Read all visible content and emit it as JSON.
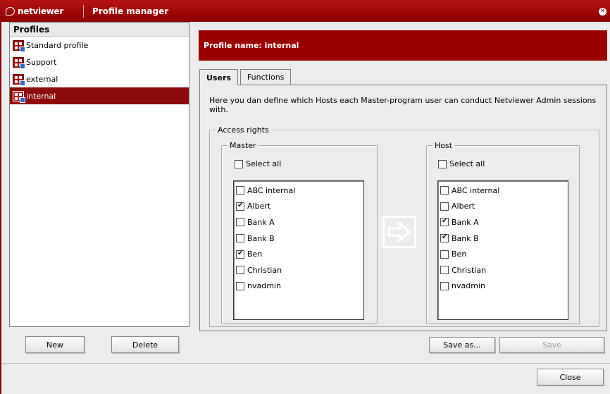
{
  "titlebar": {
    "brand": "netviewer",
    "title": "Profile manager",
    "close_icon": "close-icon"
  },
  "sidebar": {
    "header": "Profiles",
    "items": [
      {
        "label": "Standard profile",
        "selected": false
      },
      {
        "label": "Support",
        "selected": false
      },
      {
        "label": "external",
        "selected": false
      },
      {
        "label": "internal",
        "selected": true
      }
    ],
    "new_label": "New",
    "delete_label": "Delete"
  },
  "banner": {
    "text": "Profile name: internal"
  },
  "tabs": [
    {
      "label": "Users",
      "active": true
    },
    {
      "label": "Functions",
      "active": false
    }
  ],
  "description": "Here you dan define which Hosts each Master-program user can conduct Netviewer Admin sessions with.",
  "access_rights": {
    "legend": "Access rights",
    "master": {
      "legend": "Master",
      "select_all_label": "Select all",
      "select_all_checked": false,
      "users": [
        {
          "label": "ABC internal",
          "checked": false
        },
        {
          "label": "Albert",
          "checked": true
        },
        {
          "label": "Bank A",
          "checked": false
        },
        {
          "label": "Bank B",
          "checked": false
        },
        {
          "label": "Ben",
          "checked": true
        },
        {
          "label": "Christian",
          "checked": false
        },
        {
          "label": "nvadmin",
          "checked": false
        }
      ]
    },
    "host": {
      "legend": "Host",
      "select_all_label": "Select all",
      "select_all_checked": false,
      "users": [
        {
          "label": "ABC internal",
          "checked": false
        },
        {
          "label": "Albert",
          "checked": false
        },
        {
          "label": "Bank A",
          "checked": true
        },
        {
          "label": "Bank B",
          "checked": true
        },
        {
          "label": "Ben",
          "checked": false
        },
        {
          "label": "Christian",
          "checked": false
        },
        {
          "label": "nvadmin",
          "checked": false
        }
      ]
    }
  },
  "footer": {
    "save_as_label": "Save as...",
    "save_label": "Save",
    "close_label": "Close"
  },
  "colors": {
    "brand_red": "#8c0000",
    "banner_red": "#9a0000",
    "selected_row": "#8c0a0a"
  }
}
